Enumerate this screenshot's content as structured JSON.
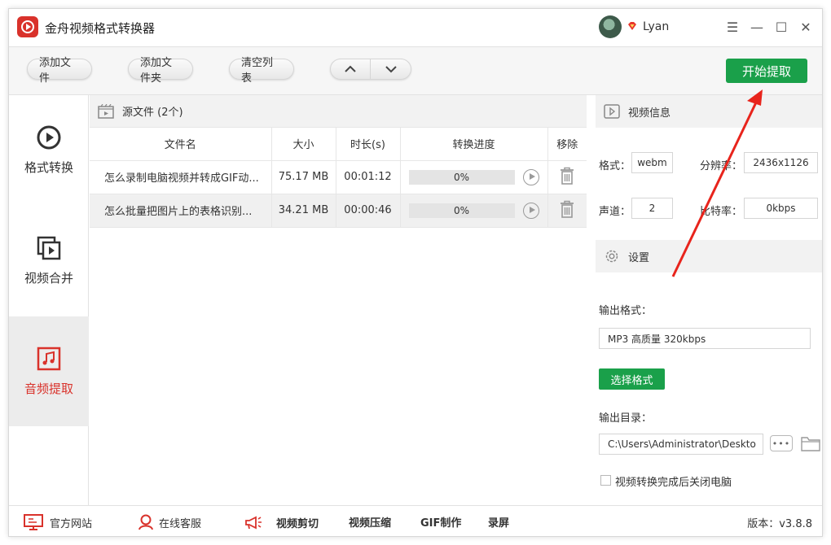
{
  "app": {
    "title": "金舟视频格式转换器",
    "username": "Lyan"
  },
  "window": {
    "menu_glyph": "☰",
    "min_glyph": "—",
    "max_glyph": "☐",
    "close_glyph": "✕"
  },
  "toolbar": {
    "add_file": "添加文件",
    "add_folder": "添加文件夹",
    "clear_list": "清空列表",
    "start": "开始提取"
  },
  "sidebar": {
    "items": [
      {
        "label": "格式转换",
        "icon": "play-circle-icon"
      },
      {
        "label": "视频合并",
        "icon": "video-merge-icon"
      },
      {
        "label": "音频提取",
        "icon": "music-note-icon",
        "active": true
      }
    ]
  },
  "file_list": {
    "header": "源文件 (2个)",
    "columns": [
      "文件名",
      "大小",
      "时长(s)",
      "转换进度",
      "移除"
    ],
    "rows": [
      {
        "name": "怎么录制电脑视频并转成GIF动...",
        "size": "75.17 MB",
        "duration": "00:01:12",
        "progress": "0%",
        "progress_value": 0
      },
      {
        "name": "怎么批量把图片上的表格识别...",
        "size": "34.21 MB",
        "duration": "00:00:46",
        "progress": "0%",
        "progress_value": 0
      }
    ]
  },
  "video_info": {
    "title": "视频信息",
    "format_label": "格式：",
    "format": "webm",
    "resolution_label": "分辨率：",
    "resolution": "2436x1126",
    "channel_label": "声道：",
    "channel": "2",
    "bitrate_label": "比特率：",
    "bitrate": "0kbps"
  },
  "settings": {
    "title": "设置",
    "output_format_label": "输出格式：",
    "output_format": "MP3 高质量 320kbps",
    "select_format": "选择格式",
    "output_dir_label": "输出目录：",
    "output_dir": "C:\\Users\\Administrator\\Deskto",
    "more_glyph": "•••",
    "shutdown_label": "视频转换完成后关闭电脑"
  },
  "statusbar": {
    "website": "官方网站",
    "support": "在线客服",
    "video_cut": "视频剪切",
    "video_compress": "视频压缩",
    "gif_make": "GIF制作",
    "record": "录屏",
    "version": "版本：v3.8.8"
  },
  "colors": {
    "accent_green": "#1aa04a",
    "brand_red": "#d9322b",
    "arrow_red": "#e8241c"
  }
}
